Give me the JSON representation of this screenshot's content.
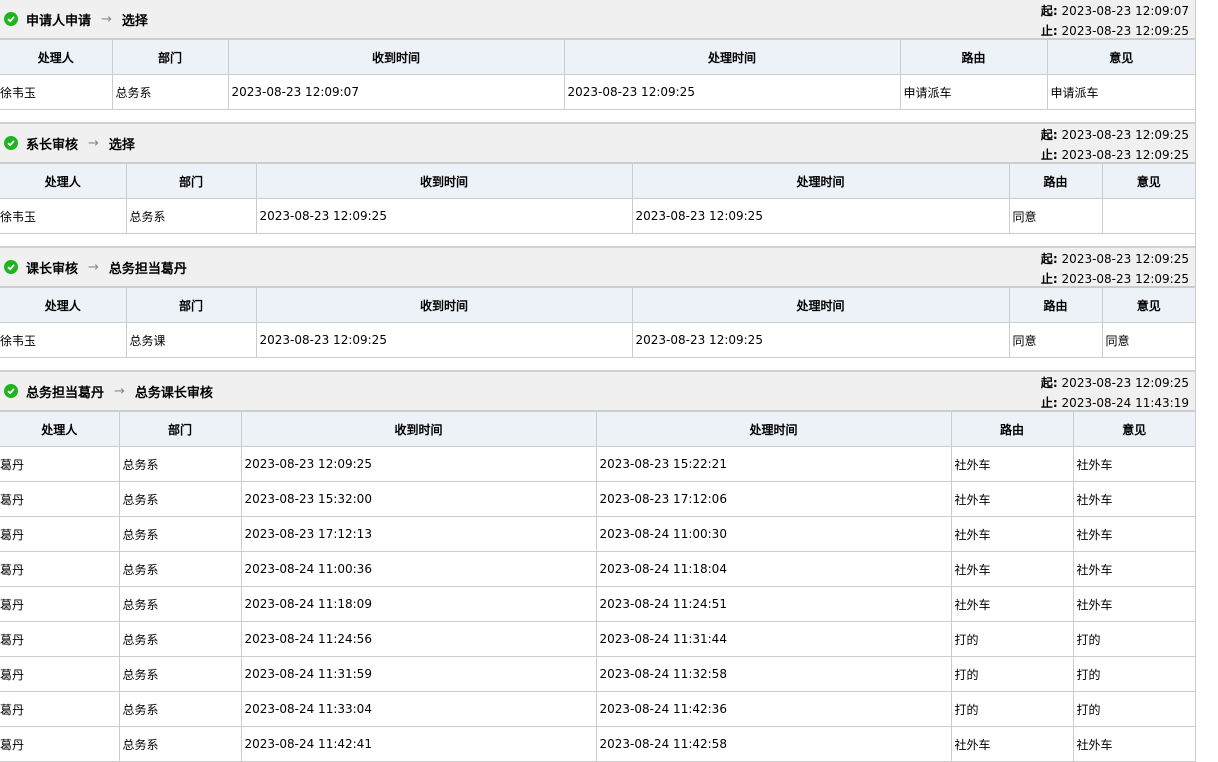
{
  "labels": {
    "start": "起:",
    "end": "止:",
    "arrow": "→"
  },
  "columns": [
    "处理人",
    "部门",
    "收到时间",
    "处理时间",
    "路由",
    "意见"
  ],
  "sections": [
    {
      "from": "申请人申请",
      "to": "选择",
      "start": "2023-08-23 12:09:07",
      "end": "2023-08-23 12:09:25",
      "rows": [
        [
          "徐韦玉",
          "总务系",
          "2023-08-23 12:09:07",
          "2023-08-23 12:09:25",
          "申请派车",
          "申请派车"
        ]
      ]
    },
    {
      "from": "系长审核",
      "to": "选择",
      "start": "2023-08-23 12:09:25",
      "end": "2023-08-23 12:09:25",
      "rows": [
        [
          "徐韦玉",
          "总务系",
          "2023-08-23 12:09:25",
          "2023-08-23 12:09:25",
          "同意",
          ""
        ]
      ]
    },
    {
      "from": "课长审核",
      "to": "总务担当葛丹",
      "start": "2023-08-23 12:09:25",
      "end": "2023-08-23 12:09:25",
      "rows": [
        [
          "徐韦玉",
          "总务课",
          "2023-08-23 12:09:25",
          "2023-08-23 12:09:25",
          "同意",
          "同意"
        ]
      ]
    },
    {
      "from": "总务担当葛丹",
      "to": "总务课长审核",
      "start": "2023-08-23 12:09:25",
      "end": "2023-08-24 11:43:19",
      "rows": [
        [
          "葛丹",
          "总务系",
          "2023-08-23 12:09:25",
          "2023-08-23 15:22:21",
          "社外车",
          "社外车"
        ],
        [
          "葛丹",
          "总务系",
          "2023-08-23 15:32:00",
          "2023-08-23 17:12:06",
          "社外车",
          "社外车"
        ],
        [
          "葛丹",
          "总务系",
          "2023-08-23 17:12:13",
          "2023-08-24 11:00:30",
          "社外车",
          "社外车"
        ],
        [
          "葛丹",
          "总务系",
          "2023-08-24 11:00:36",
          "2023-08-24 11:18:04",
          "社外车",
          "社外车"
        ],
        [
          "葛丹",
          "总务系",
          "2023-08-24 11:18:09",
          "2023-08-24 11:24:51",
          "社外车",
          "社外车"
        ],
        [
          "葛丹",
          "总务系",
          "2023-08-24 11:24:56",
          "2023-08-24 11:31:44",
          "打的",
          "打的"
        ],
        [
          "葛丹",
          "总务系",
          "2023-08-24 11:31:59",
          "2023-08-24 11:32:58",
          "打的",
          "打的"
        ],
        [
          "葛丹",
          "总务系",
          "2023-08-24 11:33:04",
          "2023-08-24 11:42:36",
          "打的",
          "打的"
        ],
        [
          "葛丹",
          "总务系",
          "2023-08-24 11:42:41",
          "2023-08-24 11:42:58",
          "社外车",
          "社外车"
        ]
      ]
    }
  ]
}
